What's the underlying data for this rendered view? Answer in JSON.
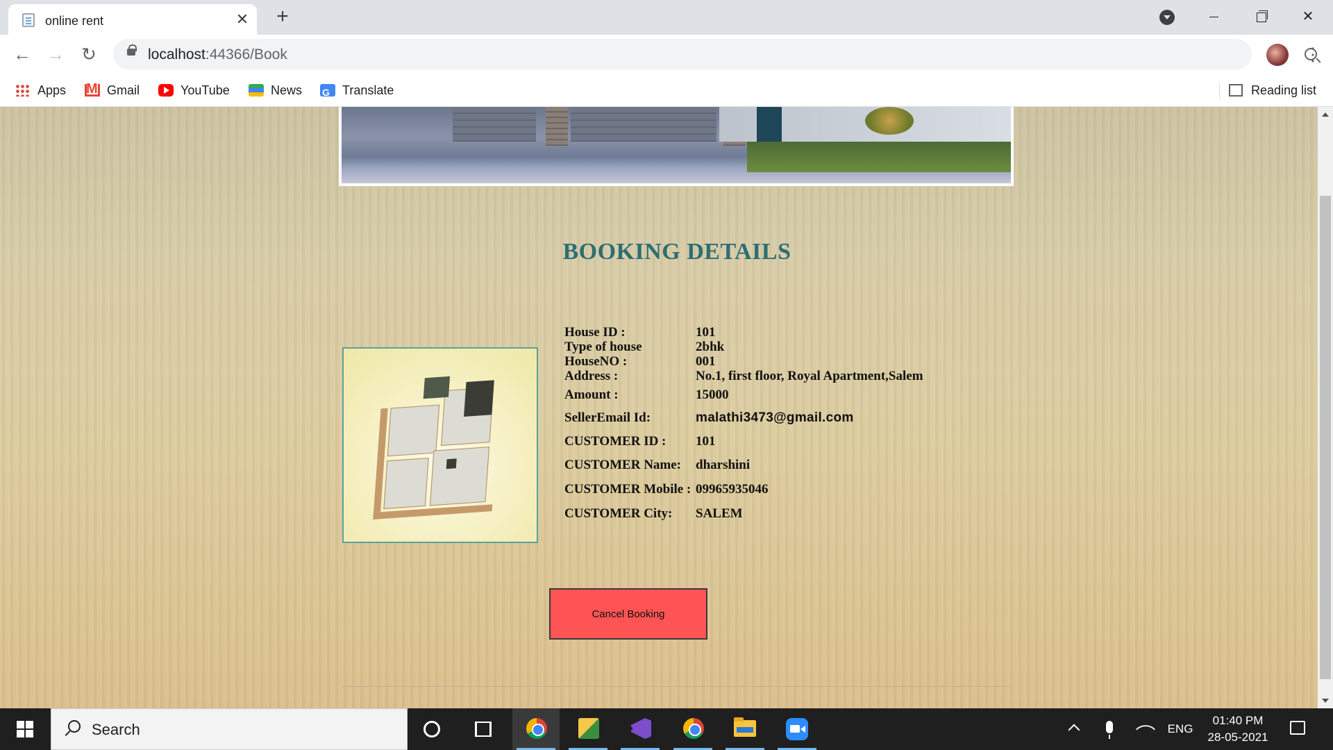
{
  "browser": {
    "tab_title": "online rent",
    "url_host": "localhost",
    "url_path": ":44366/Book",
    "bookmarks": [
      "Apps",
      "Gmail",
      "YouTube",
      "News",
      "Translate"
    ],
    "reading_list": "Reading list"
  },
  "page": {
    "heading": "BOOKING DETAILS",
    "details": [
      {
        "label": "House ID :",
        "value": "101"
      },
      {
        "label": "Type of house",
        "value": "2bhk"
      },
      {
        "label": "HouseNO :",
        "value": "001"
      },
      {
        "label": "Address :",
        "value": "No.1, first floor, Royal Apartment,Salem"
      },
      {
        "label": "Amount :",
        "value": "15000"
      },
      {
        "label": "SellerEmail Id:",
        "value": "malathi3473@gmail.com"
      },
      {
        "label": "CUSTOMER ID :",
        "value": "101"
      },
      {
        "label": "CUSTOMER Name:",
        "value": "dharshini"
      },
      {
        "label": "CUSTOMER Mobile :",
        "value": "09965935046"
      },
      {
        "label": "CUSTOMER City:",
        "value": "SALEM"
      }
    ],
    "cancel_button": "Cancel Booking",
    "colors": {
      "heading": "#2d6e73",
      "cancel_button": "#ff5454"
    }
  },
  "taskbar": {
    "search_placeholder": "Search",
    "language": "ENG",
    "time": "01:40 PM",
    "date": "28-05-2021",
    "apps": [
      "cortana-icon",
      "task-view-icon",
      "chrome-icon",
      "sql-server-icon",
      "visual-studio-icon",
      "chrome-icon",
      "file-explorer-icon",
      "zoom-icon"
    ]
  }
}
